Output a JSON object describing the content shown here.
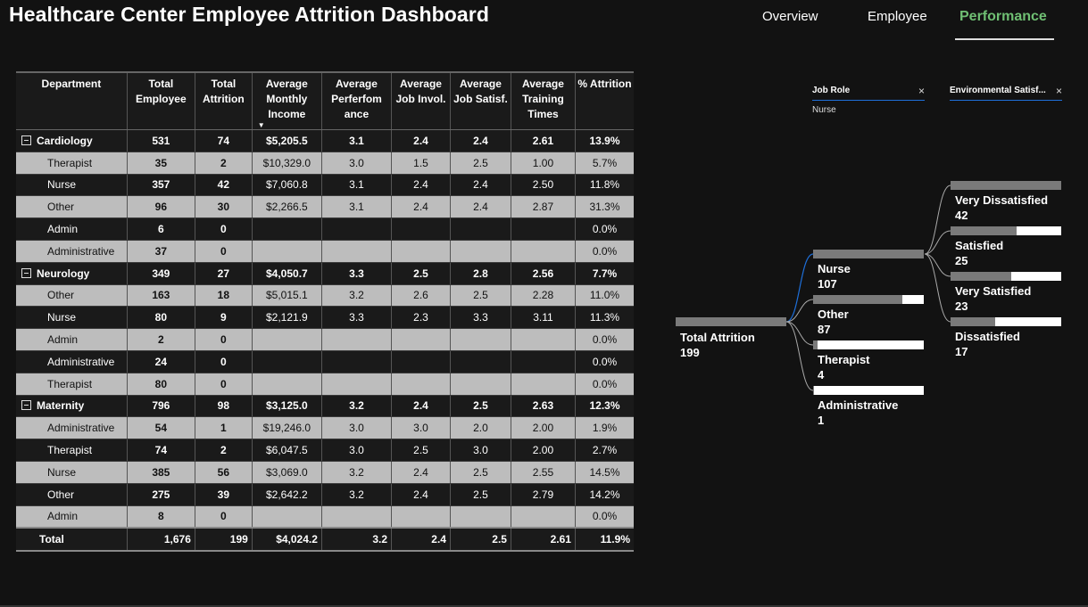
{
  "title": "Healthcare Center Employee Attrition Dashboard",
  "nav": {
    "tabs": [
      {
        "label": "Overview"
      },
      {
        "label": "Employee"
      },
      {
        "label": "Performance"
      }
    ],
    "active": "Performance"
  },
  "colors": {
    "active_tab": "#6fbf73",
    "filter_line_active": "#1e6fd9",
    "filter_line": "#1e6fd9"
  },
  "table": {
    "headers": {
      "department": "Department",
      "total_employee": "Total Employee",
      "total_attrition": "Total Attrition",
      "avg_monthly_income": "Average Monthly Income",
      "avg_performance": "Average Perferfom ance",
      "avg_job_invol": "Average Job Invol.",
      "avg_job_satisf": "Average Job Satisf.",
      "avg_training": "Average Training Times",
      "pct_attrition": "% Attrition"
    },
    "sort_indicator": "▼",
    "rows": [
      {
        "label": "Cardiology",
        "te": "531",
        "ta": "74",
        "inc": "$5,205.5",
        "perf": "3.1",
        "invol": "2.4",
        "sat": "2.4",
        "train": "2.61",
        "pct": "13.9%"
      },
      {
        "label": "Therapist",
        "te": "35",
        "ta": "2",
        "inc": "$10,329.0",
        "perf": "3.0",
        "invol": "1.5",
        "sat": "2.5",
        "train": "1.00",
        "pct": "5.7%"
      },
      {
        "label": "Nurse",
        "te": "357",
        "ta": "42",
        "inc": "$7,060.8",
        "perf": "3.1",
        "invol": "2.4",
        "sat": "2.4",
        "train": "2.50",
        "pct": "11.8%"
      },
      {
        "label": "Other",
        "te": "96",
        "ta": "30",
        "inc": "$2,266.5",
        "perf": "3.1",
        "invol": "2.4",
        "sat": "2.4",
        "train": "2.87",
        "pct": "31.3%"
      },
      {
        "label": "Admin",
        "te": "6",
        "ta": "0",
        "inc": "",
        "perf": "",
        "invol": "",
        "sat": "",
        "train": "",
        "pct": "0.0%"
      },
      {
        "label": "Administrative",
        "te": "37",
        "ta": "0",
        "inc": "",
        "perf": "",
        "invol": "",
        "sat": "",
        "train": "",
        "pct": "0.0%"
      },
      {
        "label": "Neurology",
        "te": "349",
        "ta": "27",
        "inc": "$4,050.7",
        "perf": "3.3",
        "invol": "2.5",
        "sat": "2.8",
        "train": "2.56",
        "pct": "7.7%"
      },
      {
        "label": "Other",
        "te": "163",
        "ta": "18",
        "inc": "$5,015.1",
        "perf": "3.2",
        "invol": "2.6",
        "sat": "2.5",
        "train": "2.28",
        "pct": "11.0%"
      },
      {
        "label": "Nurse",
        "te": "80",
        "ta": "9",
        "inc": "$2,121.9",
        "perf": "3.3",
        "invol": "2.3",
        "sat": "3.3",
        "train": "3.11",
        "pct": "11.3%"
      },
      {
        "label": "Admin",
        "te": "2",
        "ta": "0",
        "inc": "",
        "perf": "",
        "invol": "",
        "sat": "",
        "train": "",
        "pct": "0.0%"
      },
      {
        "label": "Administrative",
        "te": "24",
        "ta": "0",
        "inc": "",
        "perf": "",
        "invol": "",
        "sat": "",
        "train": "",
        "pct": "0.0%"
      },
      {
        "label": "Therapist",
        "te": "80",
        "ta": "0",
        "inc": "",
        "perf": "",
        "invol": "",
        "sat": "",
        "train": "",
        "pct": "0.0%"
      },
      {
        "label": "Maternity",
        "te": "796",
        "ta": "98",
        "inc": "$3,125.0",
        "perf": "3.2",
        "invol": "2.4",
        "sat": "2.5",
        "train": "2.63",
        "pct": "12.3%"
      },
      {
        "label": "Administrative",
        "te": "54",
        "ta": "1",
        "inc": "$19,246.0",
        "perf": "3.0",
        "invol": "3.0",
        "sat": "2.0",
        "train": "2.00",
        "pct": "1.9%"
      },
      {
        "label": "Therapist",
        "te": "74",
        "ta": "2",
        "inc": "$6,047.5",
        "perf": "3.0",
        "invol": "2.5",
        "sat": "3.0",
        "train": "2.00",
        "pct": "2.7%"
      },
      {
        "label": "Nurse",
        "te": "385",
        "ta": "56",
        "inc": "$3,069.0",
        "perf": "3.2",
        "invol": "2.4",
        "sat": "2.5",
        "train": "2.55",
        "pct": "14.5%"
      },
      {
        "label": "Other",
        "te": "275",
        "ta": "39",
        "inc": "$2,642.2",
        "perf": "3.2",
        "invol": "2.4",
        "sat": "2.5",
        "train": "2.79",
        "pct": "14.2%"
      },
      {
        "label": "Admin",
        "te": "8",
        "ta": "0",
        "inc": "",
        "perf": "",
        "invol": "",
        "sat": "",
        "train": "",
        "pct": "0.0%"
      }
    ],
    "total": {
      "label": "Total",
      "te": "1,676",
      "ta": "199",
      "inc": "$4,024.2",
      "perf": "3.2",
      "invol": "2.4",
      "sat": "2.5",
      "train": "2.61",
      "pct": "11.9%"
    }
  },
  "filters": {
    "job_role": {
      "label": "Job Role",
      "value": "Nurse",
      "clear": "×"
    },
    "env_satisfaction": {
      "label": "Environmental Satisf...",
      "clear": "×"
    }
  },
  "decomposition_tree": {
    "root": {
      "label": "Total Attrition",
      "value": "199"
    },
    "level1": [
      {
        "label": "Nurse",
        "value": "107",
        "fraction": 1.0
      },
      {
        "label": "Other",
        "value": "87",
        "fraction": 0.81
      },
      {
        "label": "Therapist",
        "value": "4",
        "fraction": 0.04
      },
      {
        "label": "Administrative",
        "value": "1",
        "fraction": 0.01
      }
    ],
    "level2": [
      {
        "label": "Very Dissatisfied",
        "value": "42",
        "fraction": 1.0
      },
      {
        "label": "Satisfied",
        "value": "25",
        "fraction": 0.6
      },
      {
        "label": "Very Satisfied",
        "value": "23",
        "fraction": 0.55
      },
      {
        "label": "Dissatisfied",
        "value": "17",
        "fraction": 0.4
      }
    ]
  }
}
